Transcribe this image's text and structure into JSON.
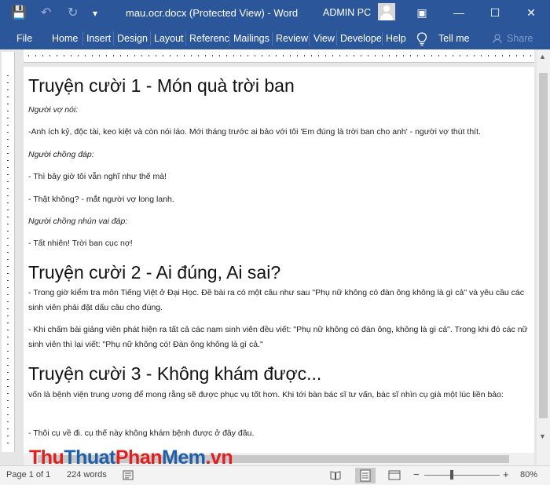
{
  "window": {
    "title": "mau.ocr.docx (Protected View)  -  Word",
    "user": "ADMIN PC",
    "minimize": "—",
    "maximize": "☐",
    "close": "✕",
    "ribbon_display": "▣"
  },
  "quick_access": {
    "save": "💾",
    "undo": "↶",
    "redo": "↻",
    "customize": "▾"
  },
  "ribbon": {
    "tabs": [
      "File",
      "Home",
      "Insert",
      "Design",
      "Layout",
      "Referenc",
      "Mailings",
      "Review",
      "View",
      "Develope",
      "Help"
    ],
    "tell_me": "Tell me",
    "share": "Share"
  },
  "document": {
    "h1": "Truyện cười 1 - Món quà trời ban",
    "p1": "Người vợ nói:",
    "p2": "-Anh ích kỷ, độc tài, keo kiệt và còn nói láo. Mới tháng trước ai bảo với tôi 'Em đúng là trời ban cho anh' - người vợ thút thít.",
    "p3": "Người chồng đáp:",
    "p4": "-   Thì bây giờ tôi vẫn nghĩ như thế mà!",
    "p5": "-   Thật không? - mắt người vợ long lanh.",
    "p6": "Người chồng nhún vai đáp:",
    "p7": "-   Tất nhiên! Trời ban cục nợ!",
    "h2": "Truyện cười 2 - Ai đúng, Ai sai?",
    "p8": "-   Trong giờ kiểm tra môn Tiếng Việt ở Đại Học. Đề bài ra có một câu như sau \"Phụ nữ không có đàn ông không là gì cả\" và yêu cầu các sinh viên phải đặt dấu câu cho đúng.",
    "p9": "-   Khi chấm bài giảng viên phát hiện ra tất cả các nam sinh viên đều viết: \"Phụ nữ không có đàn ông, không là gì cả\". Trong khi đó các nữ sinh viên thì lại viết: \"Phụ nữ không có! Đàn ông không là gì cả.\"",
    "h3": "Truyện cười 3 - Không khám được...",
    "p10": "vốn là bệnh viện trung ương để mong rằng sẽ được phục vụ tốt hơn. Khi tới bàn bác sĩ tư vấn, bác sĩ nhìn cụ già một lúc liền bảo:",
    "p11": "- Thôi cụ về đi. cụ thế này không khám bệnh được ở đây đâu."
  },
  "watermark": {
    "part1": "Thu",
    "part2": "Thuat",
    "part3": "Phan",
    "part4": "Mem",
    "part5": ".vn"
  },
  "status": {
    "page": "Page 1 of 1",
    "words": "224 words",
    "zoom": "80%",
    "zoom_minus": "−",
    "zoom_plus": "+"
  },
  "colors": {
    "word_blue": "#2b579a",
    "watermark_red": "#e02020",
    "watermark_blue": "#1f5fa8"
  }
}
